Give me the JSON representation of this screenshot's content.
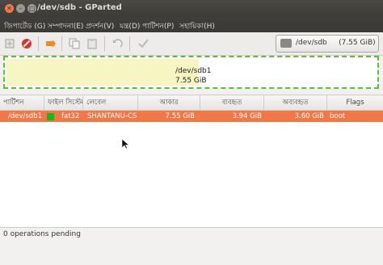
{
  "window": {
    "title": "/dev/sdb - GParted"
  },
  "menubar": {
    "items": [
      "জিপার্টেড (G)",
      "সম্পাদনা(E)",
      "প্রদর্শন(V)",
      "যন্ত্র(D)",
      "পার্টিশন(P)",
      "সহায়িকা(H)"
    ]
  },
  "toolbar": {
    "device_selector": {
      "device": "/dev/sdb",
      "size": "(7.55 GiB)"
    }
  },
  "visual": {
    "partition": "/dev/sdb1",
    "size": "7.55 GiB",
    "used_fraction": 0.52
  },
  "table": {
    "columns": [
      "পার্টিশন",
      "ফাইল সিস্টেম",
      "লেবেল",
      "আকার",
      "ব্যবহৃত",
      "অব্যবহৃত",
      "Flags"
    ],
    "rows": [
      {
        "partition": "/dev/sdb1",
        "filesystem": "fat32",
        "fs_color": "#18b81c",
        "label": "SHANTANU-CS",
        "size": "7.55 GiB",
        "used": "3.94 GiB",
        "unused": "3.60 GiB",
        "flags": "boot"
      }
    ]
  },
  "status": {
    "text": "0 operations pending"
  },
  "colors": {
    "selection": "#f07746",
    "partition_border": "#57c234",
    "used_fill": "#f7f5c1"
  }
}
